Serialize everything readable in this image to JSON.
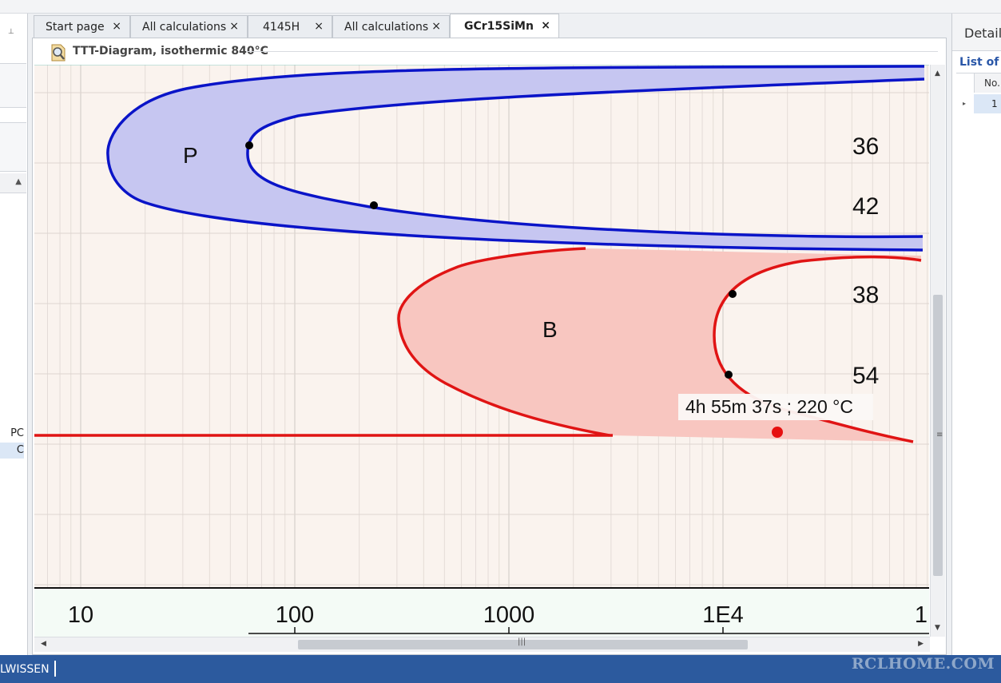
{
  "tabs": [
    {
      "label": "Start page",
      "active": false
    },
    {
      "label": "All calculations",
      "active": false
    },
    {
      "label": "4145H",
      "active": false
    },
    {
      "label": "All calculations",
      "active": false
    },
    {
      "label": "GCr15SiMn",
      "active": true
    }
  ],
  "tab_close_glyph": "×",
  "document": {
    "title": "TTT-Diagram, isothermic 840°C",
    "title_icon": "document-search-icon"
  },
  "left_panel": {
    "items": [
      {
        "text": "PC",
        "selected": false
      },
      {
        "text": "C",
        "selected": true
      }
    ]
  },
  "chart_data": {
    "type": "line",
    "x_scale": "log",
    "x_ticks": [
      "10",
      "100",
      "1000",
      "1E4",
      "1"
    ],
    "regions": [
      {
        "label": "P",
        "color": "#0a14c8",
        "fill": "#c6c6f1"
      },
      {
        "label": "B",
        "color": "#e01414",
        "fill": "#f8c6c0"
      }
    ],
    "curve_labels": [
      "36",
      "42",
      "38",
      "54"
    ],
    "cursor_tooltip": "4h 55m 37s ; 220 °C",
    "background": "#faf3ee"
  },
  "details_panel": {
    "title": "Details",
    "list_label": "List of",
    "column_header": "No.",
    "row_value": "1"
  },
  "status_bar": {
    "text": "LWISSEN",
    "watermark": "RCLHOME.COM"
  }
}
